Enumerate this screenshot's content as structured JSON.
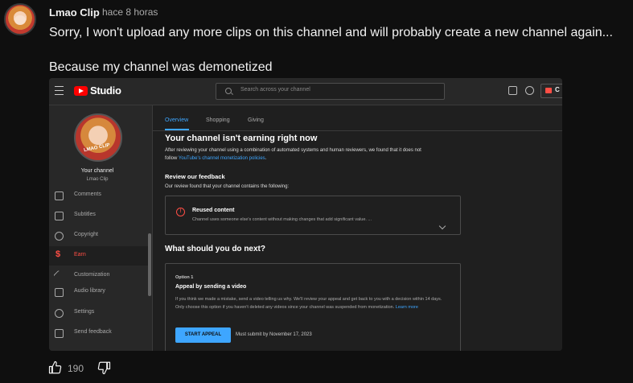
{
  "comment": {
    "author": "Lmao Clip",
    "time": "hace 8 horas",
    "text_line1": "Sorry, I won't upload any more clips on this channel and will probably create a new channel again...",
    "text_line2": "Because my channel was demonetized",
    "likes": "190"
  },
  "studio": {
    "logo_text": "Studio",
    "search_placeholder": "Search across your channel",
    "create_label": "C",
    "channel_label": "Your channel",
    "channel_name": "Lmao Clip",
    "avatar_text": "LMAO CLIP",
    "nav": [
      {
        "label": "Comments",
        "icon": "comments-icon"
      },
      {
        "label": "Subtitles",
        "icon": "subtitles-icon"
      },
      {
        "label": "Copyright",
        "icon": "copyright-icon"
      },
      {
        "label": "Earn",
        "icon": "dollar-icon"
      },
      {
        "label": "Customization",
        "icon": "magic-wand-icon"
      },
      {
        "label": "Audio library",
        "icon": "audio-library-icon"
      },
      {
        "label": "Settings",
        "icon": "gear-icon"
      },
      {
        "label": "Send feedback",
        "icon": "feedback-icon"
      }
    ],
    "tabs": [
      "Overview",
      "Shopping",
      "Giving"
    ],
    "status_title": "Your channel isn't earning right now",
    "status_body_1": "After reviewing your channel using a combination of automated systems and human reviewers, we found that it does not",
    "status_body_2_prefix": "follow ",
    "status_body_2_link": "YouTube's channel monetization policies",
    "status_body_2_suffix": ".",
    "review_title": "Review our feedback",
    "review_body": "Our review found that your channel contains the following:",
    "reused_title": "Reused content",
    "reused_body": "Channel uses someone else's content without making changes that add significant value. ...",
    "next_title": "What should you do next?",
    "option_label": "Option 1",
    "option_title": "Appeal by sending a video",
    "option_body": "If you think we made a mistake, send a video telling us why. We'll review your appeal and get back to you with a decision within 14 days. Only choose this option if you haven't deleted any videos since your channel was suspended from monetization.",
    "option_link": "Learn more",
    "appeal_button": "START APPEAL",
    "deadline": "Must submit by November 17, 2023"
  },
  "colors": {
    "accent": "#3ea6ff",
    "brand": "#ff0000",
    "earn": "#ff4e45"
  }
}
